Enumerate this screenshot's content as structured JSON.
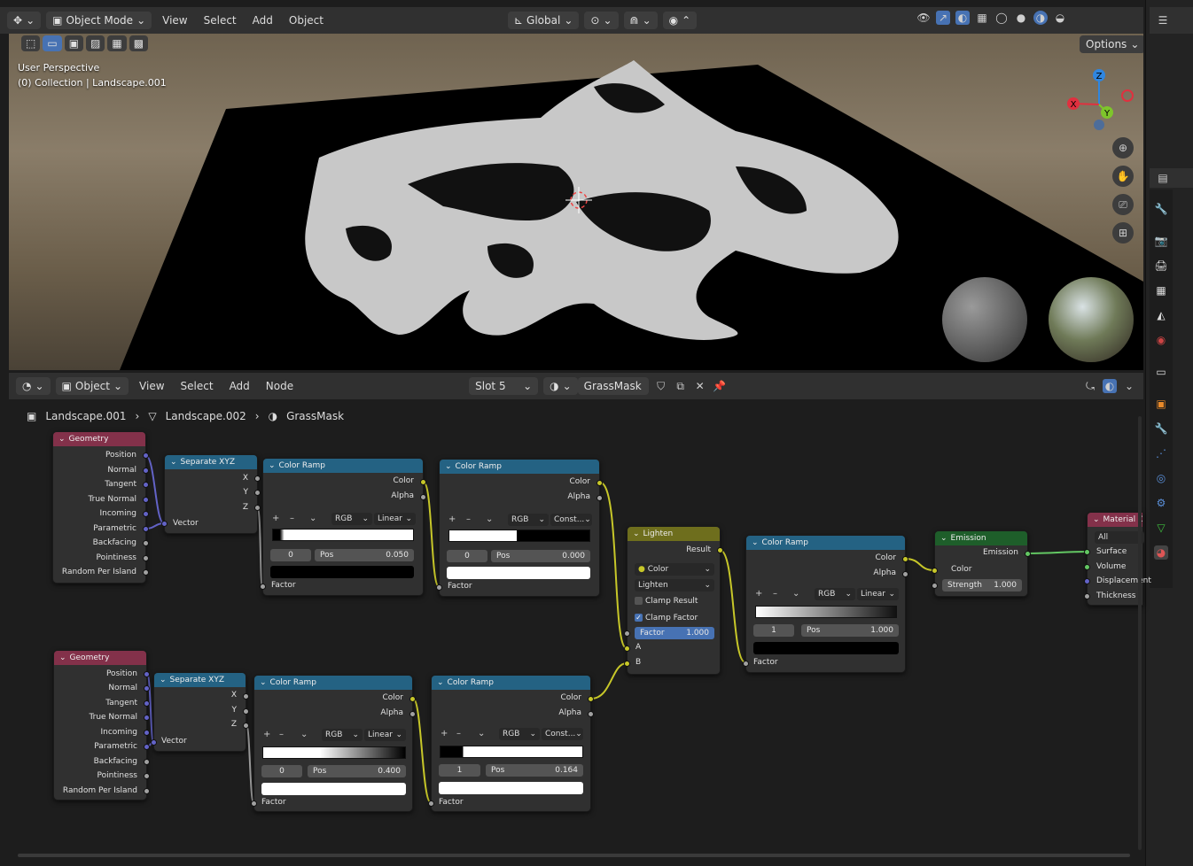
{
  "viewport": {
    "mode": "Object Mode",
    "menus": [
      "View",
      "Select",
      "Add",
      "Object"
    ],
    "transform": "Global",
    "options_label": "Options",
    "overlay_line1": "User Perspective",
    "overlay_line2": "(0) Collection | Landscape.001",
    "gizmo": {
      "x": "X",
      "y": "Y",
      "z": "Z"
    }
  },
  "node_editor": {
    "mode": "Object",
    "menus": [
      "View",
      "Select",
      "Add",
      "Node"
    ],
    "slot": "Slot 5",
    "material": "GrassMask",
    "breadcrumb": [
      "Landscape.001",
      "Landscape.002",
      "GrassMask"
    ]
  },
  "nodes": {
    "geometry_title": "Geometry",
    "geometry_outputs": [
      "Position",
      "Normal",
      "Tangent",
      "True Normal",
      "Incoming",
      "Parametric",
      "Backfacing",
      "Pointiness",
      "Random Per Island"
    ],
    "sepxyz_title": "Separate XYZ",
    "sepxyz_outputs": [
      "X",
      "Y",
      "Z"
    ],
    "sepxyz_input": "Vector",
    "ramp_title": "Color Ramp",
    "ramp_color": "Color",
    "ramp_alpha": "Alpha",
    "ramp_factor": "Factor",
    "rgb": "RGB",
    "linear": "Linear",
    "const": "Const...",
    "pos_label": "Pos",
    "ramp1": {
      "index": "0",
      "pos": "0.050"
    },
    "ramp2": {
      "index": "0",
      "pos": "0.000"
    },
    "ramp3": {
      "index": "0",
      "pos": "0.400"
    },
    "ramp4": {
      "index": "1",
      "pos": "0.164"
    },
    "ramp5": {
      "index": "1",
      "pos": "1.000"
    },
    "lighten": {
      "title": "Lighten",
      "result": "Result",
      "type": "Color",
      "blend": "Lighten",
      "clamp_result": "Clamp Result",
      "clamp_factor": "Clamp Factor",
      "factor_label": "Factor",
      "factor_value": "1.000",
      "a": "A",
      "b": "B"
    },
    "emission": {
      "title": "Emission",
      "output": "Emission",
      "color": "Color",
      "strength_label": "Strength",
      "strength_value": "1.000"
    },
    "material_output": {
      "title": "Material Out",
      "target": "All",
      "inputs": [
        "Surface",
        "Volume",
        "Displacement",
        "Thickness"
      ]
    }
  }
}
